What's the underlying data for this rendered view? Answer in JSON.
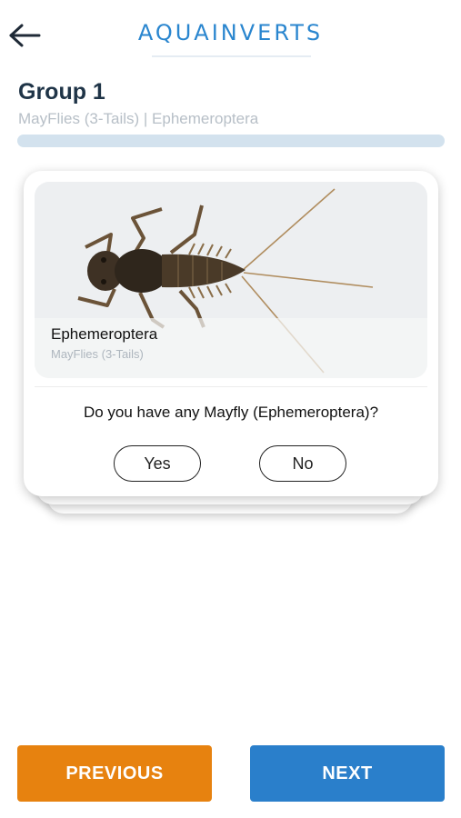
{
  "header": {
    "title": "AQUAINVERTS",
    "back_icon": "arrow-left-icon"
  },
  "group": {
    "title": "Group 1",
    "subtitle": "MayFlies (3-Tails) | Ephemeroptera",
    "progress": 0.0
  },
  "card": {
    "image_alt": "mayfly nymph photo",
    "caption_title": "Ephemeroptera",
    "caption_subtitle": "MayFlies (3-Tails)",
    "question": "Do you have any Mayfly (Ephemeroptera)?",
    "yes_label": "Yes",
    "no_label": "No"
  },
  "footer": {
    "previous_label": "PREVIOUS",
    "next_label": "NEXT"
  },
  "colors": {
    "accent": "#2a86cf",
    "previous": "#e7820f",
    "next": "#2a7fcb",
    "progress_track": "#d3e2ee"
  }
}
